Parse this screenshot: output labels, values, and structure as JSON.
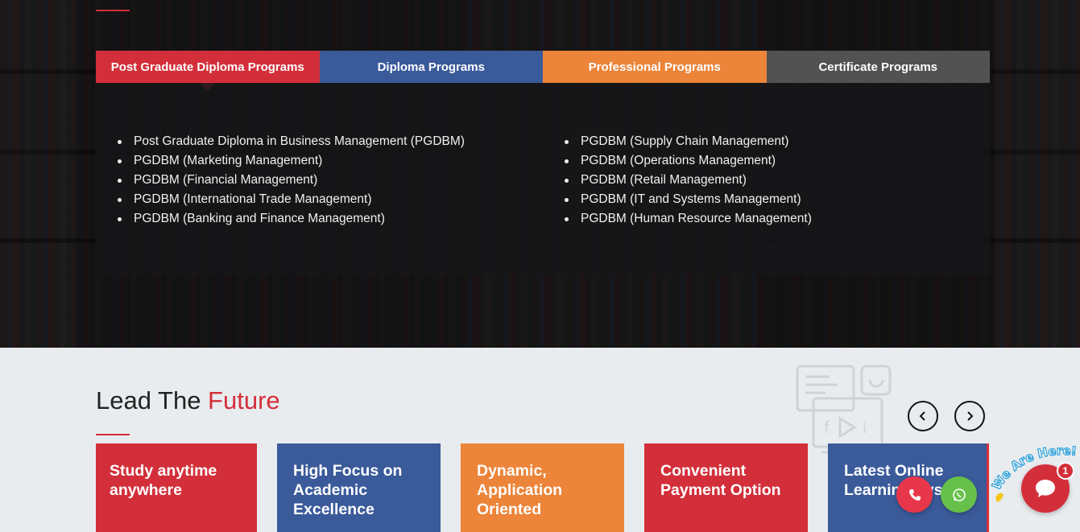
{
  "tabs": [
    {
      "label": "Post Graduate Diploma Programs",
      "color": "#d32f3a",
      "active": true
    },
    {
      "label": "Diploma Programs",
      "color": "#3a5a9a",
      "active": false
    },
    {
      "label": "Professional Programs",
      "color": "#ec8439",
      "active": false
    },
    {
      "label": "Certificate Programs",
      "color": "#525252",
      "active": false
    }
  ],
  "programs": {
    "left": [
      "Post Graduate Diploma in Business Management (PGDBM)",
      "PGDBM (Marketing Management)",
      "PGDBM (Financial Management)",
      "PGDBM (International Trade Management)",
      "PGDBM (Banking and Finance Management)"
    ],
    "right": [
      "PGDBM (Supply Chain Management)",
      "PGDBM (Operations Management)",
      "PGDBM (Retail Management)",
      "PGDBM (IT and Systems Management)",
      "PGDBM (Human Resource Management)"
    ]
  },
  "lead": {
    "title_prefix": "Lead The ",
    "title_highlight": "Future"
  },
  "carousel": {
    "prev_icon": "chevron-left-icon",
    "next_icon": "chevron-right-icon",
    "cards": [
      {
        "label": "Study anytime anywhere",
        "color": "#d32f3a"
      },
      {
        "label": "High Focus on Academic Excellence",
        "color": "#3a5a9a"
      },
      {
        "label": "Dynamic, Application Oriented",
        "color": "#ec8439"
      },
      {
        "label": "Convenient Payment Option",
        "color": "#d32f3a"
      },
      {
        "label": "Latest Online Learning Syst",
        "color": "#3a5a9a"
      }
    ]
  },
  "widgets": {
    "we_are_here": "We Are Here!",
    "chat_badge": "1",
    "phone_icon": "phone-icon",
    "whatsapp_icon": "whatsapp-icon",
    "chat_icon": "chat-bubble-icon"
  }
}
